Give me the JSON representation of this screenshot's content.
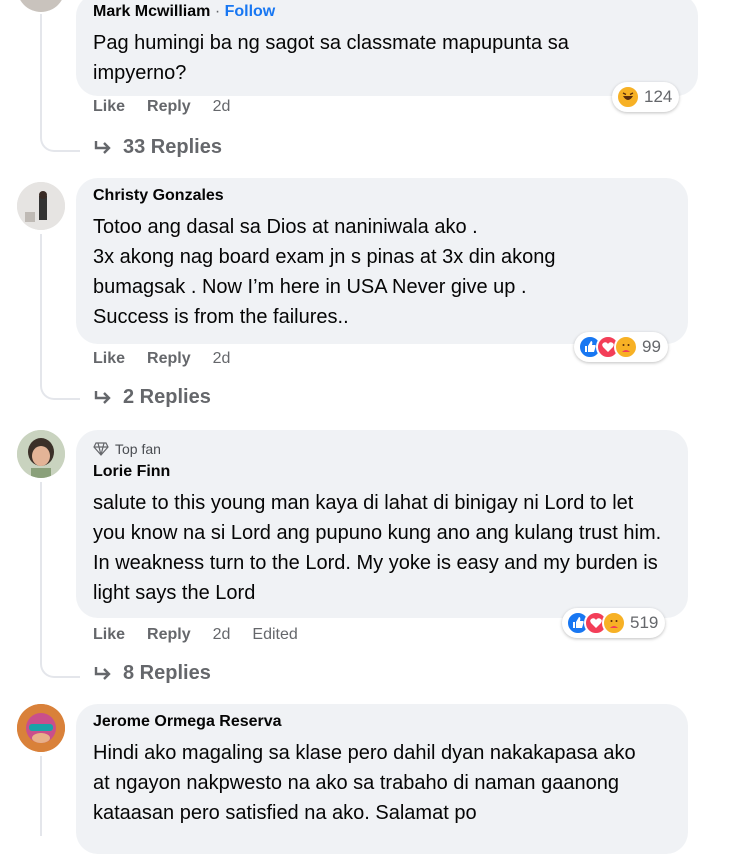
{
  "comments": [
    {
      "author": "Mark Mcwilliam",
      "separator": " · ",
      "follow": "Follow",
      "text": "Pag humingi ba ng sagot sa classmate mapupunta sa impyerno?",
      "like": "Like",
      "reply": "Reply",
      "time": "2d",
      "reaction_count": "124",
      "reactions": [
        "haha"
      ],
      "replies": "33 Replies"
    },
    {
      "author": "Christy Gonzales",
      "text": "Totoo ang dasal sa Dios at naniniwala ako .\n3x akong nag board exam jn s pinas at 3x din akong bumagsak . Now I’m here in USA Never give up .\nSuccess is from the failures..",
      "like": "Like",
      "reply": "Reply",
      "time": "2d",
      "reaction_count": "99",
      "reactions": [
        "like",
        "love",
        "care"
      ],
      "replies": "2 Replies"
    },
    {
      "badge": "Top fan",
      "author": "Lorie Finn",
      "text": "salute to this young man kaya di lahat di binigay ni Lord to let you know na si Lord ang pupuno kung ano ang kulang trust him. In weakness turn to the Lord. My yoke is easy and my burden is light says the Lord",
      "like": "Like",
      "reply": "Reply",
      "time": "2d",
      "edited": "Edited",
      "reaction_count": "519",
      "reactions": [
        "like",
        "love",
        "care"
      ],
      "replies": "8 Replies"
    },
    {
      "author": "Jerome Ormega Reserva",
      "text": "Hindi ako magaling sa klase pero dahil dyan nakakapasa ako at ngayon nakpwesto na ako sa trabaho di naman gaanong kataasan pero satisfied na ako. Salamat po"
    }
  ],
  "colors": {
    "accent": "#1877f2",
    "bubble": "#f0f2f5",
    "meta": "#65676b"
  }
}
